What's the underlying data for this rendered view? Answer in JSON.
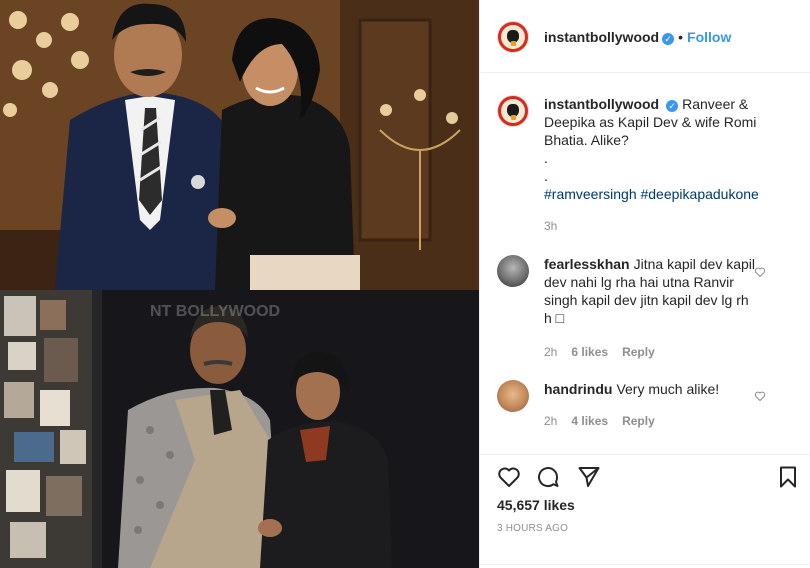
{
  "post": {
    "username": "instantbollywood",
    "verified_mark": "✓",
    "separator": "•",
    "follow_label": "Follow",
    "caption": {
      "username": "instantbollywood",
      "line1": "Ranveer & Deepika as Kapil Dev & wife Romi Bhatia. Alike?",
      "dots": [
        ".",
        "."
      ],
      "hashtags": "#ramveersingh #deepikapadukone",
      "time": "3h"
    },
    "comments": [
      {
        "username": "fearlesskhan",
        "text": "Jitna kapil dev kapil dev nahi lg rha hai utna Ranvir singh kapil dev jitn kapil dev lg rh h □",
        "time": "2h",
        "likes": "6 likes",
        "reply": "Reply"
      },
      {
        "username": "handrindu",
        "text": "Very much alike!",
        "time": "2h",
        "likes": "4 likes",
        "reply": "Reply"
      }
    ],
    "likes_count": "45,657 likes",
    "posted_ago": "3 HOURS AGO",
    "photo_watermark": "NT BOLLYWOOD"
  },
  "icons": {
    "like": "heart-icon",
    "comment": "comment-bubble-icon",
    "share": "paper-plane-icon",
    "save": "bookmark-icon",
    "comment_like": "heart-icon"
  },
  "colors": {
    "link_blue": "#3897f0",
    "hashtag": "#00376b",
    "muted": "#8e8e8e",
    "text": "#262626",
    "brand_red": "#d9291f"
  }
}
